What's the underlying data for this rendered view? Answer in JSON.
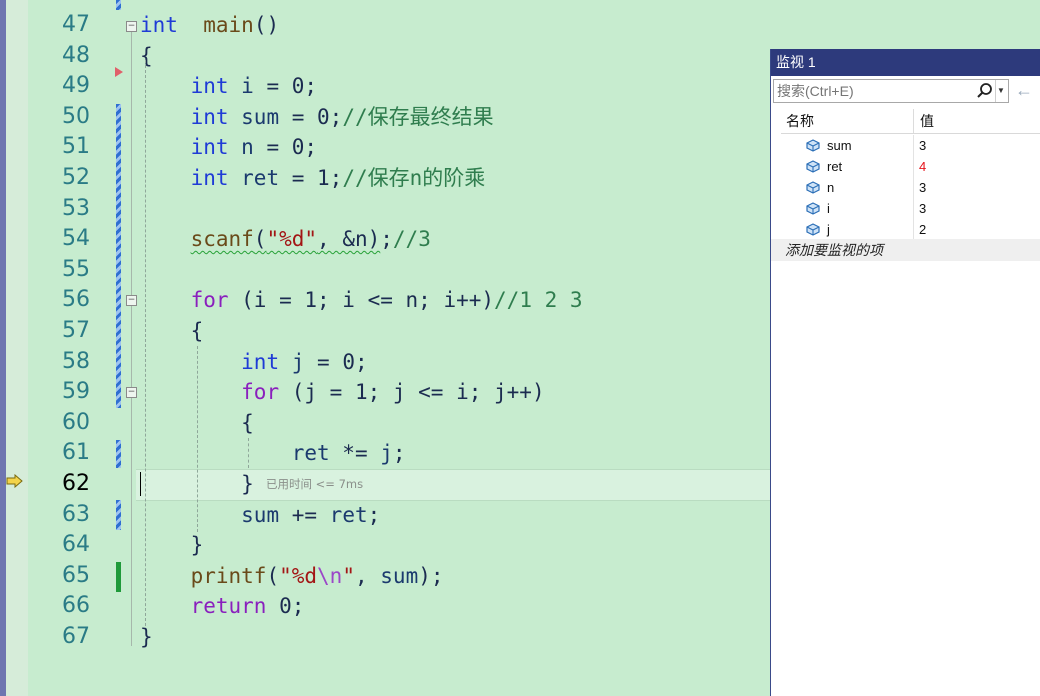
{
  "editor": {
    "perf_tip": "已用时间 <= 7ms",
    "current_line": 62,
    "lines": [
      {
        "n": "47",
        "parts": [
          [
            "kw",
            "int"
          ],
          [
            "",
            "  "
          ],
          [
            "fn",
            "main"
          ],
          [
            "",
            "()"
          ]
        ]
      },
      {
        "n": "48",
        "parts": [
          [
            "",
            "{"
          ]
        ]
      },
      {
        "n": "49",
        "parts": [
          [
            "",
            "    "
          ],
          [
            "kw",
            "int"
          ],
          [
            "var",
            " i"
          ],
          [
            "",
            " = 0;"
          ]
        ]
      },
      {
        "n": "50",
        "parts": [
          [
            "",
            "    "
          ],
          [
            "kw",
            "int"
          ],
          [
            "var",
            " sum"
          ],
          [
            "",
            " = 0;"
          ],
          [
            "cmt",
            "//保存最终结果"
          ]
        ]
      },
      {
        "n": "51",
        "parts": [
          [
            "",
            "    "
          ],
          [
            "kw",
            "int"
          ],
          [
            "var",
            " n"
          ],
          [
            "",
            " = 0;"
          ]
        ]
      },
      {
        "n": "52",
        "parts": [
          [
            "",
            "    "
          ],
          [
            "kw",
            "int"
          ],
          [
            "var",
            " ret"
          ],
          [
            "",
            " = 1;"
          ],
          [
            "cmt",
            "//保存n的阶乘"
          ]
        ]
      },
      {
        "n": "53",
        "parts": []
      },
      {
        "n": "54",
        "parts": [
          [
            "",
            "    "
          ],
          [
            "fn squiggle",
            "scanf"
          ],
          [
            "squiggle",
            "("
          ],
          [
            "str squiggle",
            "\"%d\""
          ],
          [
            "squiggle",
            ", &n)"
          ],
          [
            "",
            ";"
          ],
          [
            "cmt",
            "//3"
          ]
        ]
      },
      {
        "n": "55",
        "parts": []
      },
      {
        "n": "56",
        "parts": [
          [
            "",
            "    "
          ],
          [
            "kw2",
            "for"
          ],
          [
            "",
            " (i = 1; i <= n; i++)"
          ],
          [
            "cmt",
            "//1 2 3"
          ]
        ]
      },
      {
        "n": "57",
        "parts": [
          [
            "",
            "    {"
          ]
        ]
      },
      {
        "n": "58",
        "parts": [
          [
            "",
            "        "
          ],
          [
            "kw",
            "int"
          ],
          [
            "var",
            " j"
          ],
          [
            "",
            " = 0;"
          ]
        ]
      },
      {
        "n": "59",
        "parts": [
          [
            "",
            "        "
          ],
          [
            "kw2",
            "for"
          ],
          [
            "",
            " (j = 1; j <= i; j++)"
          ]
        ]
      },
      {
        "n": "60",
        "parts": [
          [
            "",
            "        {"
          ]
        ]
      },
      {
        "n": "61",
        "parts": [
          [
            "",
            "            "
          ],
          [
            "var",
            "ret"
          ],
          [
            "",
            " *= "
          ],
          [
            "var",
            "j"
          ],
          [
            "",
            ";"
          ]
        ]
      },
      {
        "n": "62",
        "parts": [
          [
            "",
            "        }"
          ]
        ]
      },
      {
        "n": "63",
        "parts": [
          [
            "",
            "        "
          ],
          [
            "var",
            "sum"
          ],
          [
            "",
            " += "
          ],
          [
            "var",
            "ret"
          ],
          [
            "",
            ";"
          ]
        ]
      },
      {
        "n": "64",
        "parts": [
          [
            "",
            "    }"
          ]
        ]
      },
      {
        "n": "65",
        "parts": [
          [
            "",
            "    "
          ],
          [
            "fn",
            "printf"
          ],
          [
            "",
            "("
          ],
          [
            "str",
            "\"%d"
          ],
          [
            "esc",
            "\\n"
          ],
          [
            "str",
            "\""
          ],
          [
            "",
            ", "
          ],
          [
            "var",
            "sum"
          ],
          [
            "",
            ");"
          ]
        ]
      },
      {
        "n": "66",
        "parts": [
          [
            "",
            "    "
          ],
          [
            "kw2",
            "return"
          ],
          [
            "",
            " 0;"
          ]
        ]
      },
      {
        "n": "67",
        "parts": [
          [
            "",
            "}"
          ]
        ]
      }
    ]
  },
  "watch": {
    "title": "监视 1",
    "search_placeholder": "搜索(Ctrl+E)",
    "col_name": "名称",
    "col_value": "值",
    "items": [
      {
        "name": "sum",
        "value": "3",
        "changed": false
      },
      {
        "name": "ret",
        "value": "4",
        "changed": true
      },
      {
        "name": "n",
        "value": "3",
        "changed": false
      },
      {
        "name": "i",
        "value": "3",
        "changed": false
      },
      {
        "name": "j",
        "value": "2",
        "changed": false
      }
    ],
    "add_item": "添加要监视的项"
  },
  "colors": {
    "editor_bg": "#c7eccf",
    "keyword": "#1f3bd6",
    "control_keyword": "#8a1fbd",
    "comment": "#2f7d4e",
    "changed_value": "#e5141b"
  }
}
